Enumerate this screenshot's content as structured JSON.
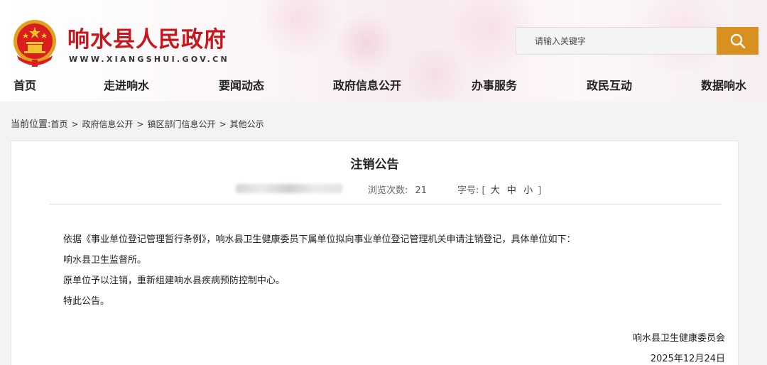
{
  "header": {
    "site_title": "响水县人民政府",
    "site_url": "WWW.XIANGSHUI.GOV.CN",
    "emblem_icon": "national-emblem-icon",
    "brand_color": "#c8161d"
  },
  "search": {
    "placeholder": "请输入关键字",
    "button_icon": "search-icon",
    "button_color": "#d8901e"
  },
  "nav": {
    "items": [
      {
        "label": "首页"
      },
      {
        "label": "走进响水"
      },
      {
        "label": "要闻动态"
      },
      {
        "label": "政府信息公开"
      },
      {
        "label": "办事服务"
      },
      {
        "label": "政民互动"
      },
      {
        "label": "数据响水"
      }
    ]
  },
  "breadcrumb": {
    "lead": "当前位置:",
    "items": [
      {
        "label": "首页"
      },
      {
        "label": "政府信息公开"
      },
      {
        "label": "镇区部门信息公开"
      },
      {
        "label": "其他公示"
      }
    ],
    "separator": ">"
  },
  "article": {
    "title": "注销公告",
    "views_label": "浏览次数:",
    "views_count": "21",
    "font_label": "字号:",
    "font_open": "[",
    "font_large": "大",
    "font_medium": "中",
    "font_small": "小",
    "font_close": "]",
    "paragraphs": [
      "依据《事业单位登记管理暂行条例》，响水县卫生健康委员下属单位拟向事业单位登记管理机关申请注销登记，具体单位如下：",
      "响水县卫生监督所。",
      "原单位予以注销，重新组建响水县疾病预防控制中心。",
      "特此公告。"
    ],
    "signature_org": "响水县卫生健康委员会",
    "signature_date": "2025年12月24日"
  }
}
